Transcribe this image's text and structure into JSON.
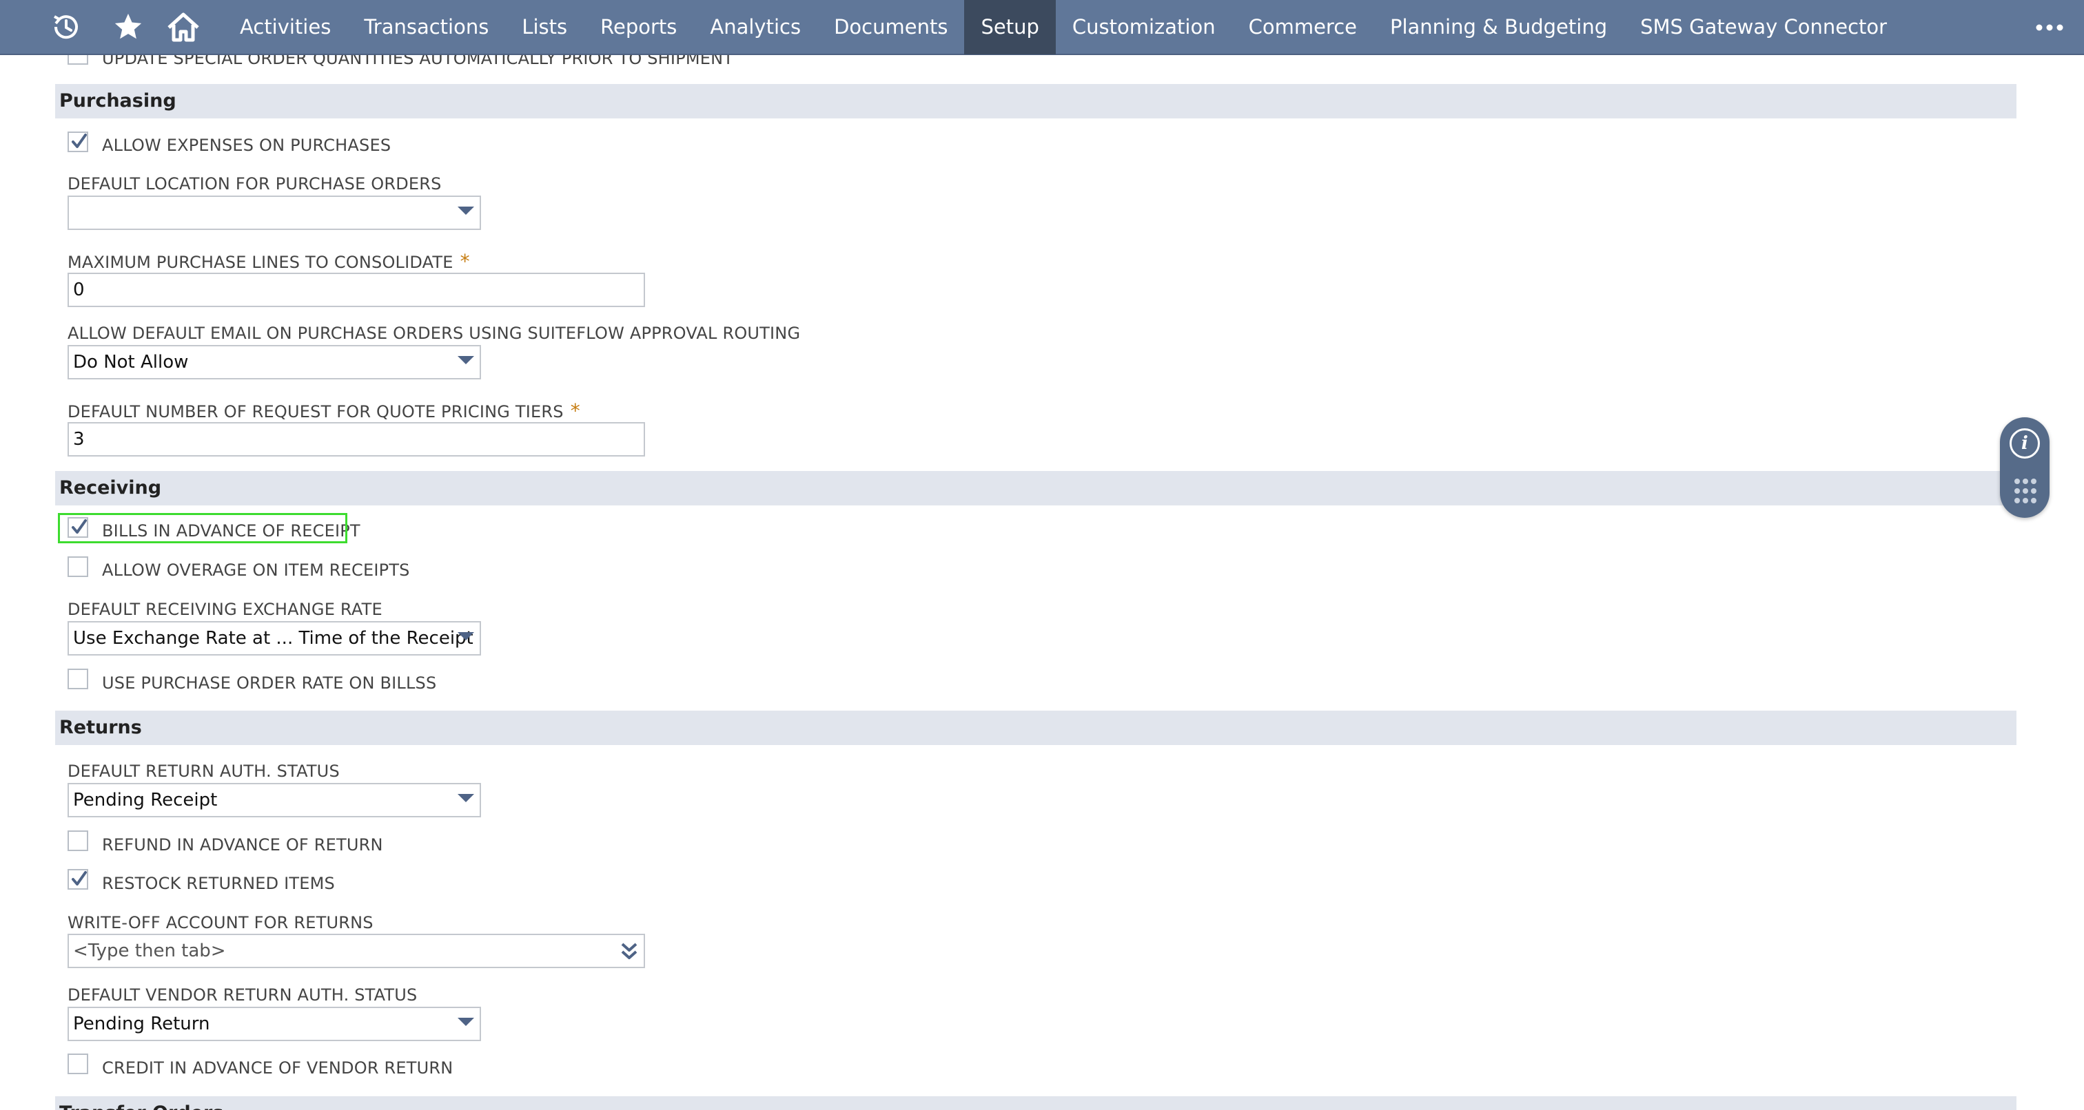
{
  "nav": {
    "items": [
      {
        "label": "Activities"
      },
      {
        "label": "Transactions"
      },
      {
        "label": "Lists"
      },
      {
        "label": "Reports"
      },
      {
        "label": "Analytics"
      },
      {
        "label": "Documents"
      },
      {
        "label": "Setup",
        "active": true
      },
      {
        "label": "Customization"
      },
      {
        "label": "Commerce"
      },
      {
        "label": "Planning & Budgeting"
      },
      {
        "label": "SMS Gateway Connector"
      }
    ],
    "icons": [
      "recent-records-icon",
      "favorites-star-icon",
      "home-icon",
      "more-menu-icon"
    ]
  },
  "top_partial": {
    "label": "UPDATE SPECIAL ORDER QUANTITIES AUTOMATICALLY PRIOR TO SHIPMENT"
  },
  "purchasing": {
    "title": "Purchasing",
    "allow_expenses": {
      "label": "ALLOW EXPENSES ON PURCHASES",
      "checked": true
    },
    "default_location": {
      "label": "DEFAULT LOCATION FOR PURCHASE ORDERS",
      "value": ""
    },
    "max_lines": {
      "label": "MAXIMUM PURCHASE LINES TO CONSOLIDATE",
      "required": "*",
      "value": "0"
    },
    "default_email": {
      "label": "ALLOW DEFAULT EMAIL ON PURCHASE ORDERS USING SUITEFLOW APPROVAL ROUTING",
      "value": "Do Not Allow"
    },
    "rfq_tiers": {
      "label": "DEFAULT NUMBER OF REQUEST FOR QUOTE PRICING TIERS",
      "required": "*",
      "value": "3"
    }
  },
  "receiving": {
    "title": "Receiving",
    "bills_in_advance": {
      "label": "BILLS IN ADVANCE OF RECEIPT",
      "checked": true
    },
    "allow_overage": {
      "label": "ALLOW OVERAGE ON ITEM RECEIPTS",
      "checked": false
    },
    "exchange_rate": {
      "label": "DEFAULT RECEIVING EXCHANGE RATE",
      "value": "Use Exchange Rate at ... Time of the Receipt"
    },
    "po_rate": {
      "label": "USE PURCHASE ORDER RATE ON BILLSS",
      "checked": false
    }
  },
  "returns": {
    "title": "Returns",
    "return_auth_status": {
      "label": "DEFAULT RETURN AUTH. STATUS",
      "value": "Pending Receipt"
    },
    "refund_in_advance": {
      "label": "REFUND IN ADVANCE OF RETURN",
      "checked": false
    },
    "restock": {
      "label": "RESTOCK RETURNED ITEMS",
      "checked": true
    },
    "writeoff_account": {
      "label": "WRITE-OFF ACCOUNT FOR RETURNS",
      "placeholder": "<Type then tab>"
    },
    "vendor_return_status": {
      "label": "DEFAULT VENDOR RETURN AUTH. STATUS",
      "value": "Pending Return"
    },
    "credit_in_advance": {
      "label": "CREDIT IN ADVANCE OF VENDOR RETURN",
      "checked": false
    }
  },
  "next_section_partial": {
    "title": "Transfer Orders"
  },
  "widget": {
    "info_glyph": "i"
  },
  "colors": {
    "nav_bg": "#607799",
    "nav_active": "#3c4a5e",
    "section_bg": "#e1e5ed",
    "checkmark": "#4e6386",
    "required_star": "#c67d12",
    "highlight": "#3ddc2f"
  }
}
